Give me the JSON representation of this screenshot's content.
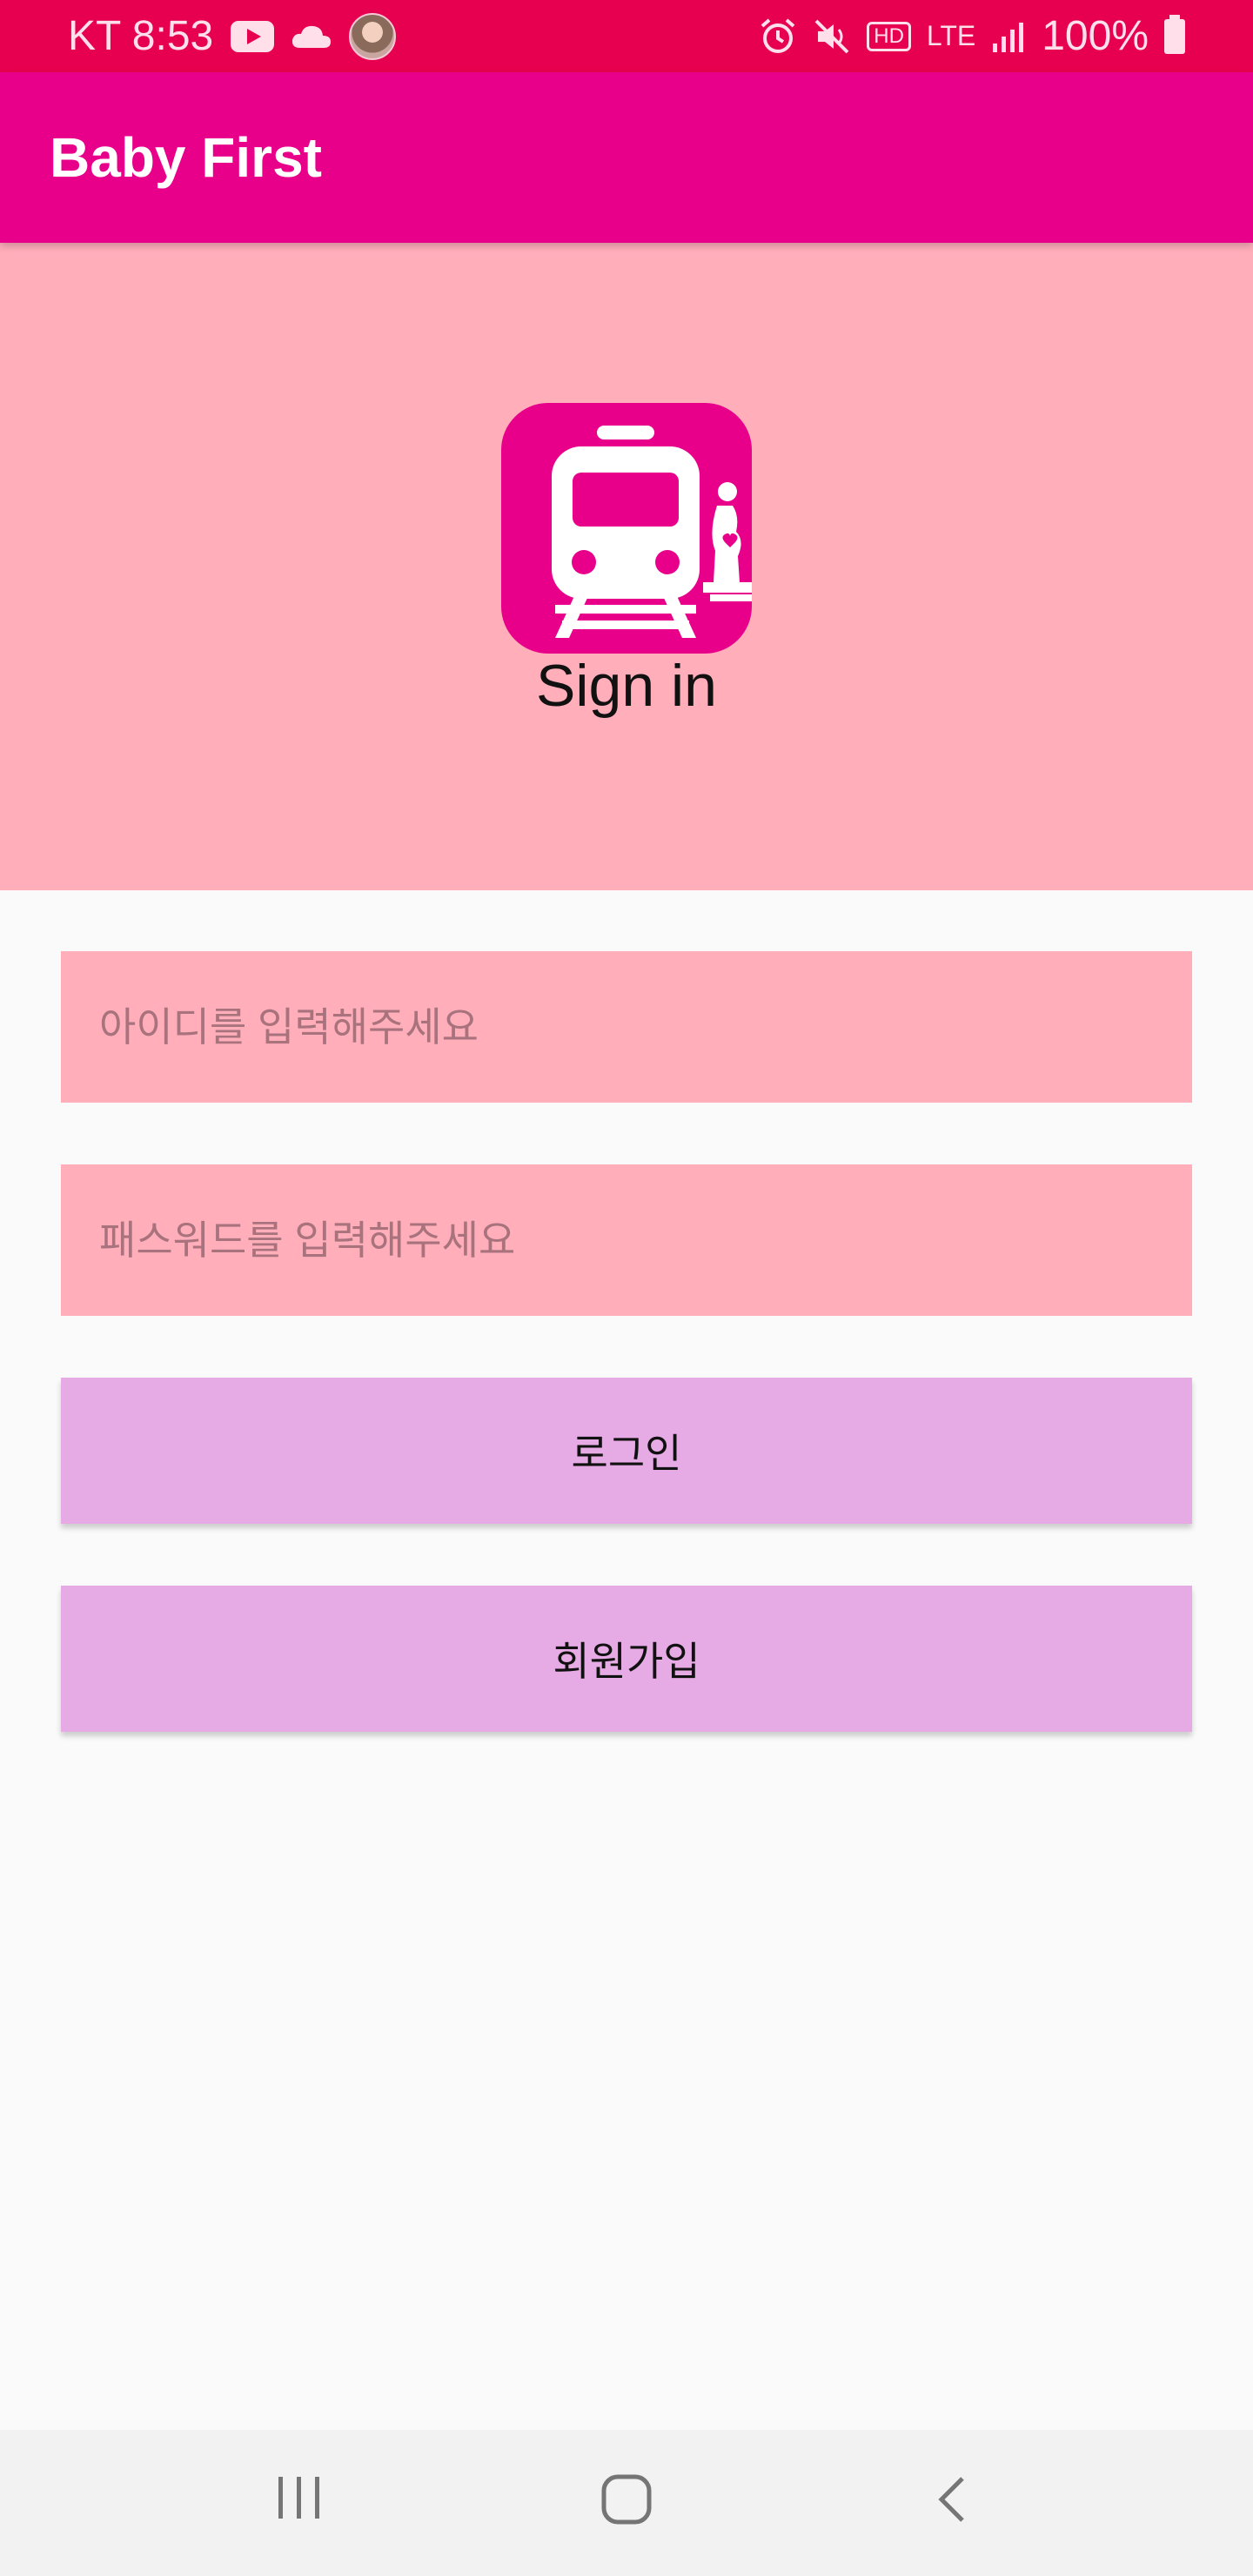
{
  "status_bar": {
    "carrier_time": "KT 8:53",
    "hd": "HD",
    "network": "LTE",
    "battery": "100%",
    "icons": [
      "youtube-icon",
      "cloud-icon",
      "avatar",
      "alarm-icon",
      "mute-icon",
      "signal-icon",
      "battery-icon"
    ]
  },
  "app_bar": {
    "title": "Baby First"
  },
  "header": {
    "logo_icon": "subway-train-pregnant-woman-icon",
    "title": "Sign in"
  },
  "form": {
    "id_placeholder": "아이디를 입력해주세요",
    "password_placeholder": "패스워드를 입력해주세요",
    "login_label": "로그인",
    "signup_label": "회원가입"
  },
  "nav_bar": {
    "icons": [
      "recent-apps-icon",
      "home-icon",
      "back-icon"
    ]
  },
  "colors": {
    "status_bar": "#e6004f",
    "app_bar": "#e8008b",
    "header_panel": "#ffaeba",
    "input_bg": "#ffaeba",
    "button_bg": "#e6aae4",
    "background": "#fafafa"
  }
}
